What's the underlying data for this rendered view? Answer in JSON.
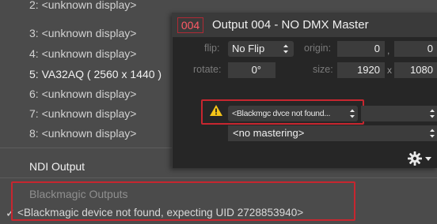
{
  "menu": {
    "items": [
      {
        "label": "2: <unknown display>"
      },
      {
        "label": "3: <unknown display>"
      },
      {
        "label": "4: <unknown display>"
      },
      {
        "label": "5: VA32AQ ( 2560 x 1440 )"
      },
      {
        "label": "6: <unknown display>"
      },
      {
        "label": "7: <unknown display>"
      },
      {
        "label": "8: <unknown display>"
      }
    ],
    "ndi_output": "NDI Output",
    "blackmagic_header": "Blackmagic Outputs",
    "checkmark": "✓",
    "blackmagic_item": "<Blackmagic device not found, expecting UID 2728853940>"
  },
  "panel": {
    "output_number": "004",
    "title": "Output 004 - NO DMX Master",
    "flip_label": "flip:",
    "flip_value": "No Flip",
    "origin_label": "origin:",
    "origin_x": "0",
    "origin_sep": ",",
    "origin_y": "0",
    "rotate_label": "rotate:",
    "rotate_value": "0°",
    "size_label": "size:",
    "size_w": "1920",
    "size_sep": "x",
    "size_h": "1080",
    "device_select": "<Blackmgc dvce not found...",
    "mastering_select": "<no mastering>",
    "gear_menu": "gear-menu"
  },
  "colors": {
    "highlight": "#c7262f",
    "warning": "#f5c518"
  }
}
